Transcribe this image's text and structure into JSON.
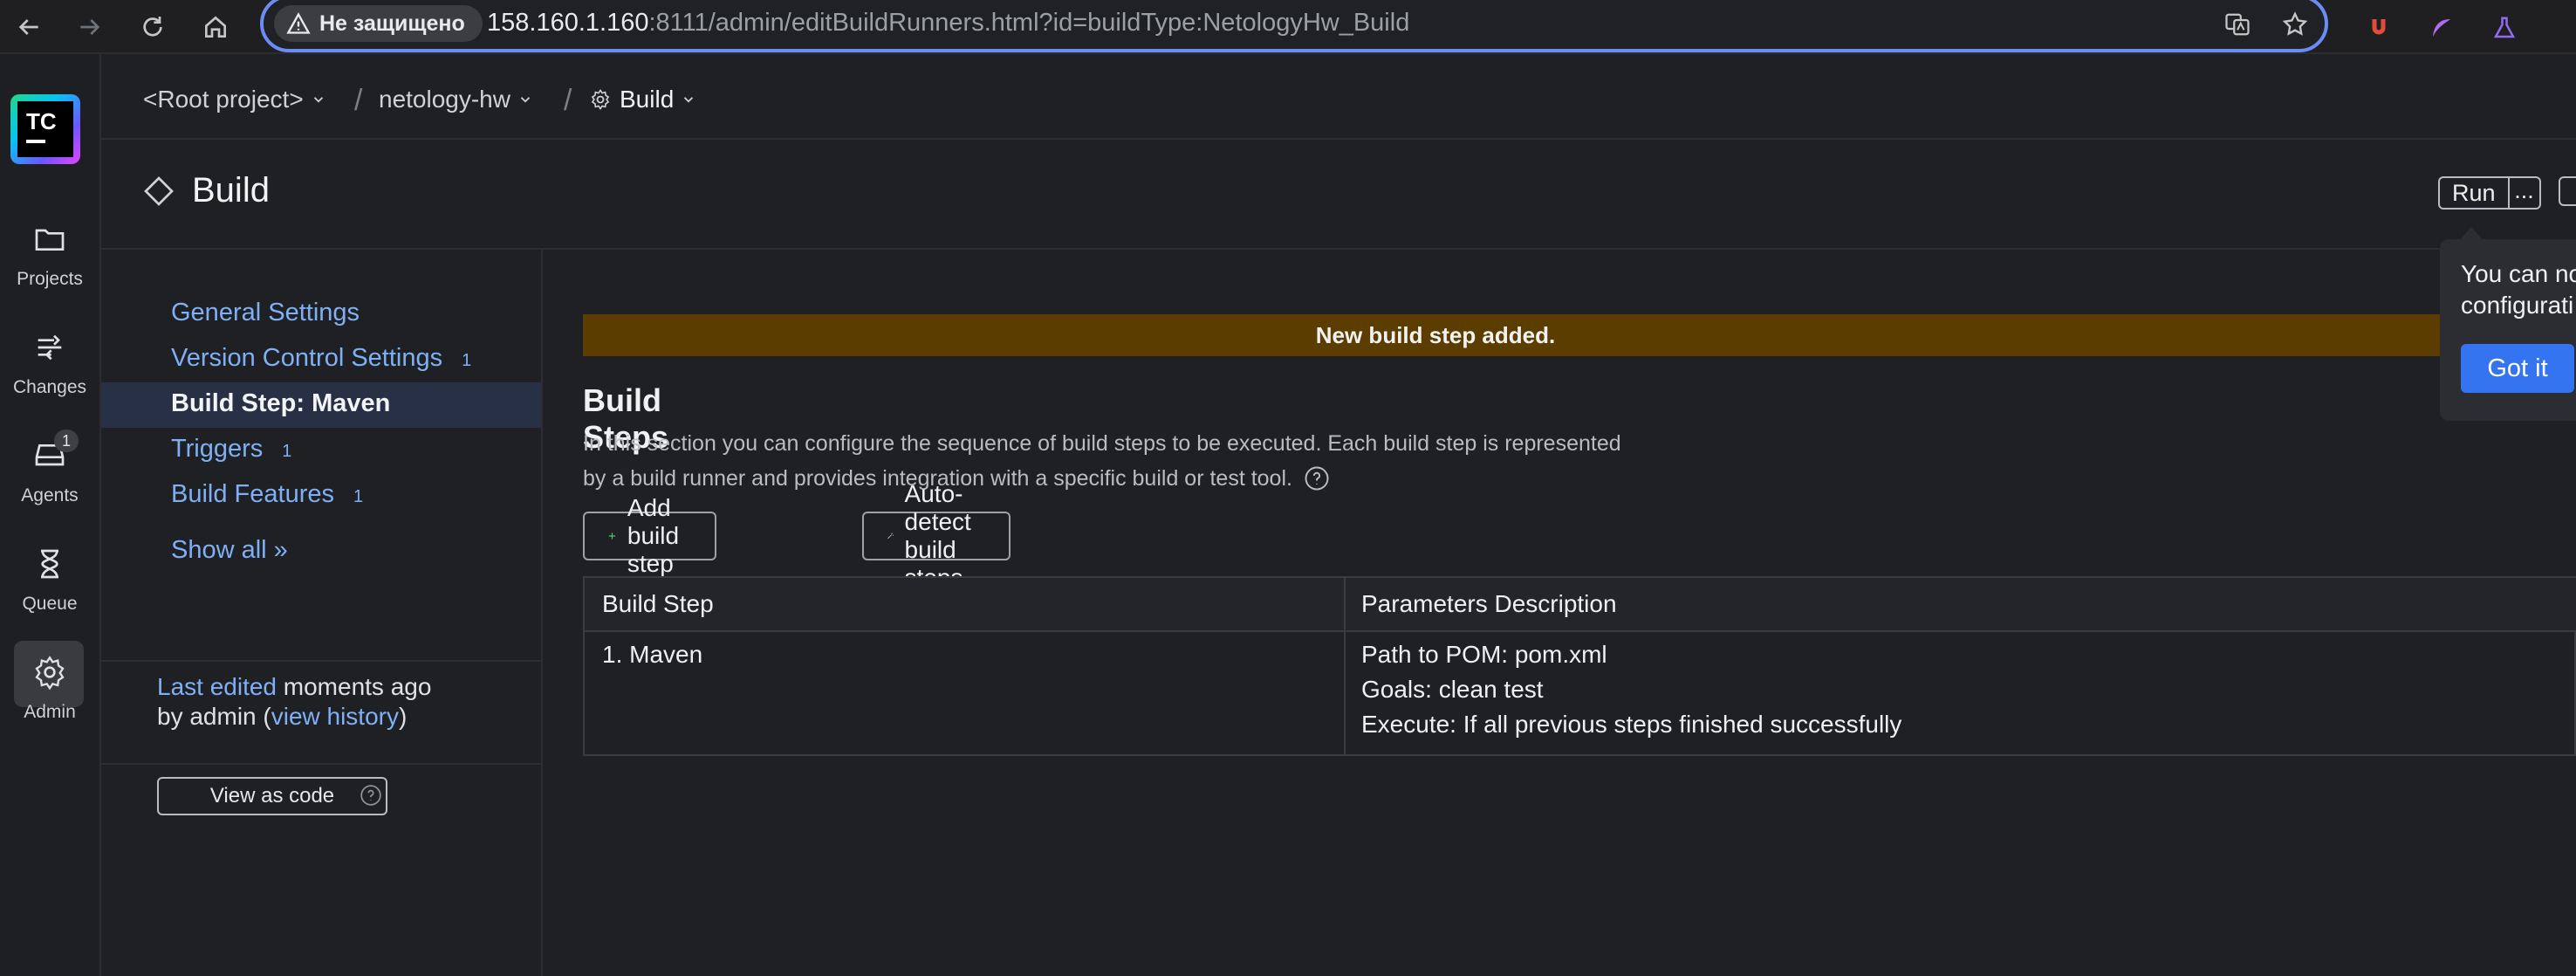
{
  "browser": {
    "security_label": "Не защищено",
    "url_host": "158.160.1.160",
    "url_path": ":8111/admin/editBuildRunners.html?id=buildType:NetologyHw_Build"
  },
  "rail": {
    "items": [
      {
        "label": "Projects",
        "icon": "folder-icon"
      },
      {
        "label": "Changes",
        "icon": "changes-icon"
      },
      {
        "label": "Agents",
        "icon": "agents-icon",
        "badge": "1"
      },
      {
        "label": "Queue",
        "icon": "hourglass-icon"
      },
      {
        "label": "Admin",
        "icon": "gear-icon"
      }
    ],
    "logo_text": "TC"
  },
  "breadcrumb": {
    "root": "<Root project>",
    "project": "netology-hw",
    "build": "Build",
    "separator": "/"
  },
  "header": {
    "title": "Build",
    "run_label": "Run",
    "more_label": "..."
  },
  "sidebar": {
    "items": [
      {
        "label": "General Settings",
        "count": ""
      },
      {
        "label": "Version Control Settings",
        "count": "1"
      },
      {
        "label": "Build Step: Maven",
        "count": ""
      },
      {
        "label": "Triggers",
        "count": "1"
      },
      {
        "label": "Build Features",
        "count": "1"
      }
    ],
    "show_all": "Show all »",
    "last_edited_link": "Last edited",
    "last_edited_when": " moments ago",
    "by_admin": "by admin  (",
    "view_history": "view history",
    "close_paren": ")",
    "view_as_code": "View as code"
  },
  "main": {
    "flash": "New build step added.",
    "section_title": "Build Steps",
    "description_line1": "In this section you can configure the sequence of build steps to be executed. Each build step is represented",
    "description_line2": "by a build runner and provides integration with a specific build or test tool.",
    "add_build_step": "Add build step",
    "auto_detect": "Auto-detect build steps",
    "table": {
      "headers": [
        "Build Step",
        "Parameters Description"
      ],
      "rows": [
        {
          "step": "1. Maven",
          "params": [
            "Path to POM: pom.xml",
            "Goals: clean test",
            "Execute: If all previous steps finished successfully"
          ]
        }
      ]
    }
  },
  "popup": {
    "line1": "You can no",
    "line2": "configurati",
    "button": "Got it"
  },
  "colors": {
    "accent": "#3574f0",
    "link": "#7fb0f5",
    "flash_bg": "#5c3d00",
    "background": "#1f2023"
  }
}
